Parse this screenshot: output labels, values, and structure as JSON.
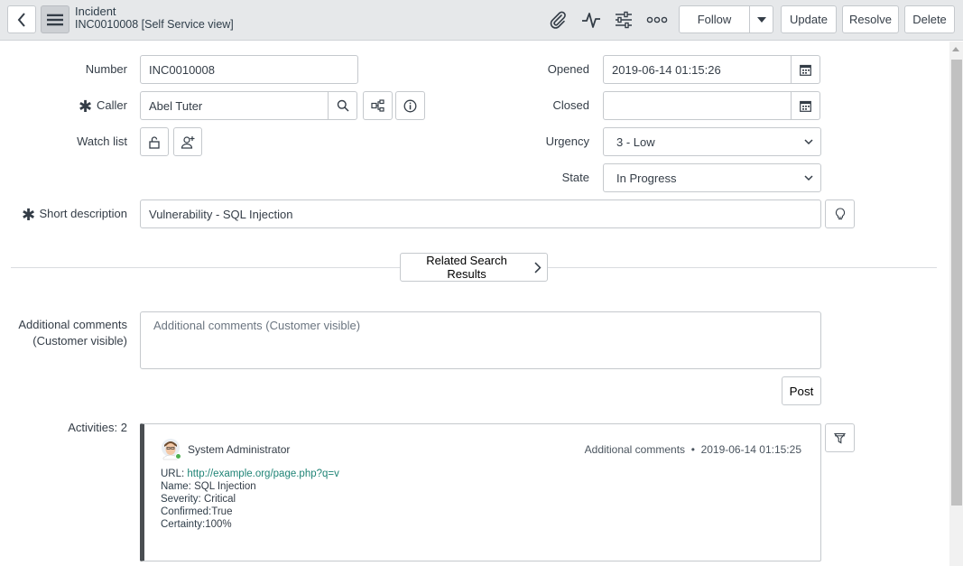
{
  "header": {
    "title": "Incident",
    "subtitle": "INC0010008 [Self Service view]",
    "follow_label": "Follow",
    "update_label": "Update",
    "resolve_label": "Resolve",
    "delete_label": "Delete"
  },
  "form": {
    "number_label": "Number",
    "number_value": "INC0010008",
    "caller_label": "Caller",
    "caller_value": "Abel Tuter",
    "watch_label": "Watch list",
    "opened_label": "Opened",
    "opened_value": "2019-06-14 01:15:26",
    "closed_label": "Closed",
    "closed_value": "",
    "urgency_label": "Urgency",
    "urgency_value": "3 - Low",
    "state_label": "State",
    "state_value": "In Progress",
    "short_desc_label": "Short description",
    "short_desc_value": "Vulnerability - SQL Injection",
    "related_label": "Related Search Results",
    "comments_label_1": "Additional comments",
    "comments_label_2": "(Customer visible)",
    "comments_placeholder": "Additional comments (Customer visible)",
    "post_label": "Post",
    "activities_label": "Activities: 2"
  },
  "activity": {
    "author": "System Administrator",
    "meta": "Additional comments  •  2019-06-14 01:15:25",
    "lines": [
      {
        "key": "URL: ",
        "value": "http://example.org/page.php?q=v"
      },
      {
        "key": "Name: ",
        "value": "SQL Injection"
      },
      {
        "key": "Severity: ",
        "value": "Critical"
      },
      {
        "key": "Confirmed:",
        "value": "True"
      },
      {
        "key": "Certainty:",
        "value": "100%"
      }
    ]
  },
  "colors": {
    "header_bg": "#e6e8ea",
    "link": "#1f8476",
    "presence": "#4cb050"
  }
}
